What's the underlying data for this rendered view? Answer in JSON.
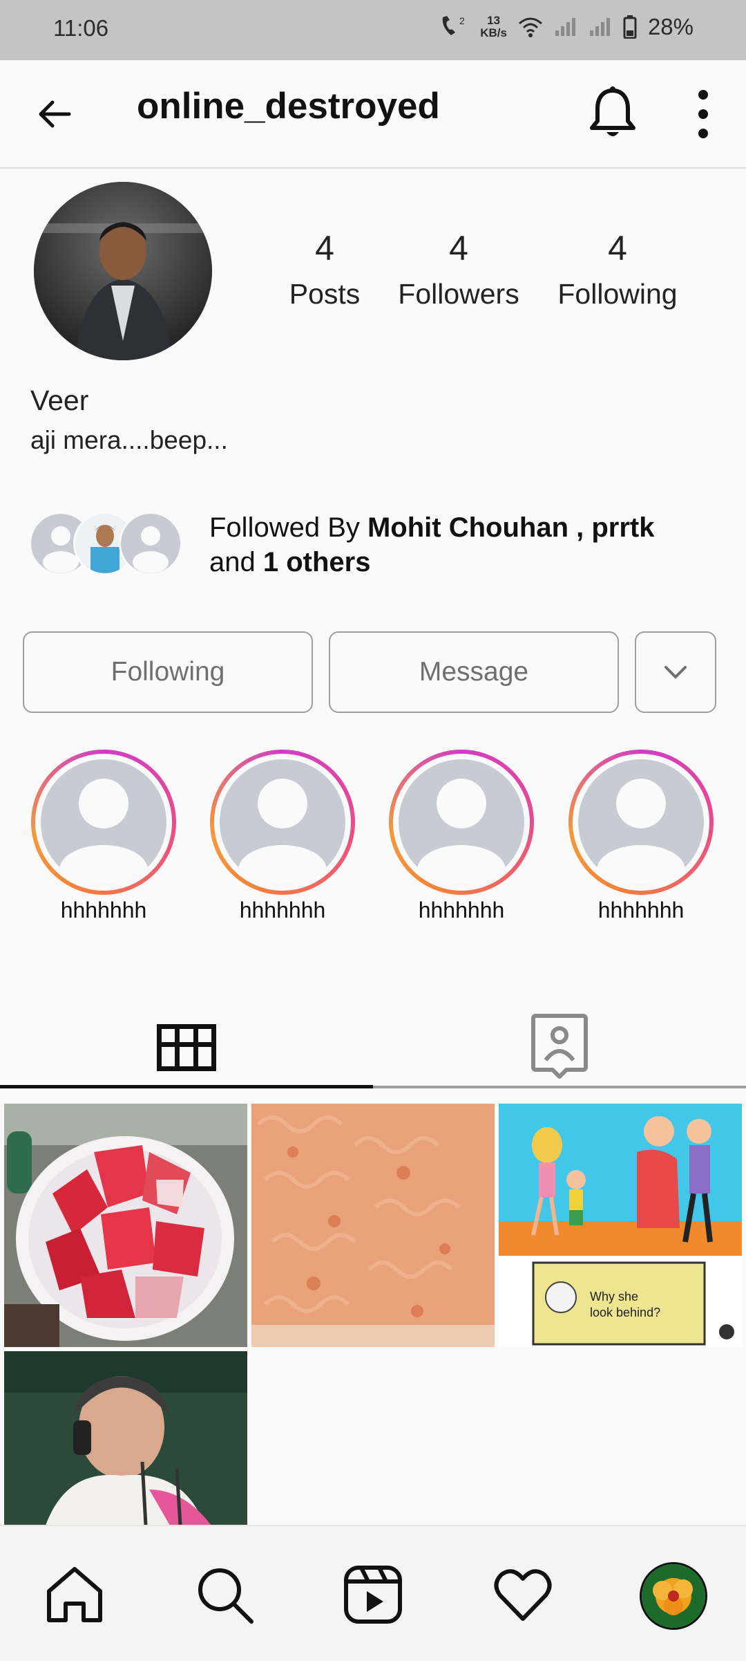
{
  "status": {
    "time": "11:06",
    "netspeed_value": "13",
    "netspeed_unit": "KB/s",
    "battery": "28%"
  },
  "header": {
    "username": "online_destroyed"
  },
  "profile": {
    "posts_count": "4",
    "posts_label": "Posts",
    "followers_count": "4",
    "followers_label": "Followers",
    "following_count": "4",
    "following_label": "Following",
    "name": "Veer",
    "bio": "aji mera....beep..."
  },
  "followed_by": {
    "prefix": "Followed By ",
    "names": "Mohit Chouhan , prrtk",
    "and": "and ",
    "others": "1 others"
  },
  "buttons": {
    "following": "Following",
    "message": "Message"
  },
  "highlights": [
    {
      "label": "hhhhhhh"
    },
    {
      "label": "hhhhhhh"
    },
    {
      "label": "hhhhhhh"
    },
    {
      "label": "hhhhhhh"
    }
  ],
  "posts": [
    {
      "caption": "Why she look behind?"
    }
  ],
  "icons": {
    "back": "arrow-left-icon",
    "bell": "bell-icon",
    "more": "more-vertical-icon",
    "grid_tab": "grid-icon",
    "tagged_tab": "tagged-person-icon",
    "home": "home-icon",
    "search": "search-icon",
    "reels": "reels-icon",
    "activity": "heart-icon",
    "profile": "profile-avatar-icon"
  }
}
